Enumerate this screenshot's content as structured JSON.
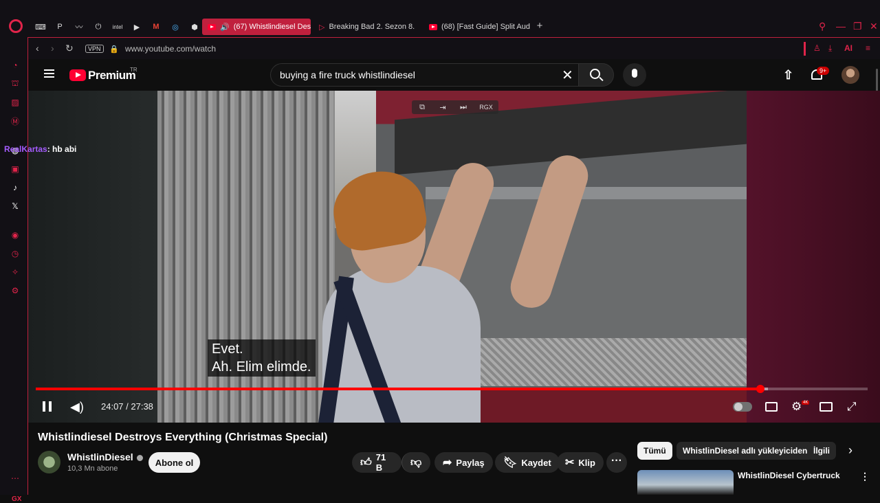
{
  "browser": {
    "tabs": [
      {
        "label": "(67) Whistlindiesel Des",
        "active": true
      },
      {
        "label": "Breaking Bad 2. Sezon 8. B"
      },
      {
        "label": "(68) [Fast Guide] Split Aud"
      }
    ],
    "favorites": [
      "controller-icon",
      "paypal-icon",
      "pulse-icon",
      "power-icon",
      "intel-icon",
      "play-icon",
      "gmail-icon",
      "chrome-icon",
      "chatgpt-icon"
    ],
    "favorite_glyphs": [
      "⌨",
      "P",
      "〰",
      "⏻",
      "intel",
      "▶",
      "M",
      "◎",
      "⬢"
    ],
    "vpn_label": "VPN",
    "url": "www.youtube.com/watch",
    "ai_label": "AI",
    "accent_color": "#e0244a",
    "gx_label": "GX"
  },
  "youtube": {
    "brand": "Premium",
    "region": "TR",
    "search_query": "buying a fire truck whistlindiesel",
    "notification_count": "9+"
  },
  "player": {
    "overlay_label": "RGX",
    "caption_line1": "Evet.",
    "caption_line2": "Ah.  Elim elimde.",
    "chat_user": "RealKartas",
    "chat_message": ": hb abi",
    "time": "24:07 / 27:38",
    "progress_fraction": 0.871,
    "buffered_fraction": 0.88,
    "hd_badge": "4K"
  },
  "video": {
    "title": "Whistlindiesel Destroys Everything (Christmas Special)",
    "channel": "WhistlinDiesel",
    "subscribers": "10,3 Mn abone",
    "subscribe_label": "Abone ol",
    "likes": "71 B",
    "share_label": "Paylaş",
    "save_label": "Kaydet",
    "clip_label": "Klip"
  },
  "recommendations": {
    "chips": [
      "Tümü",
      "WhistlinDiesel adlı yükleyiciden",
      "İlgili"
    ],
    "first_title": "WhistlinDiesel Cybertruck"
  }
}
